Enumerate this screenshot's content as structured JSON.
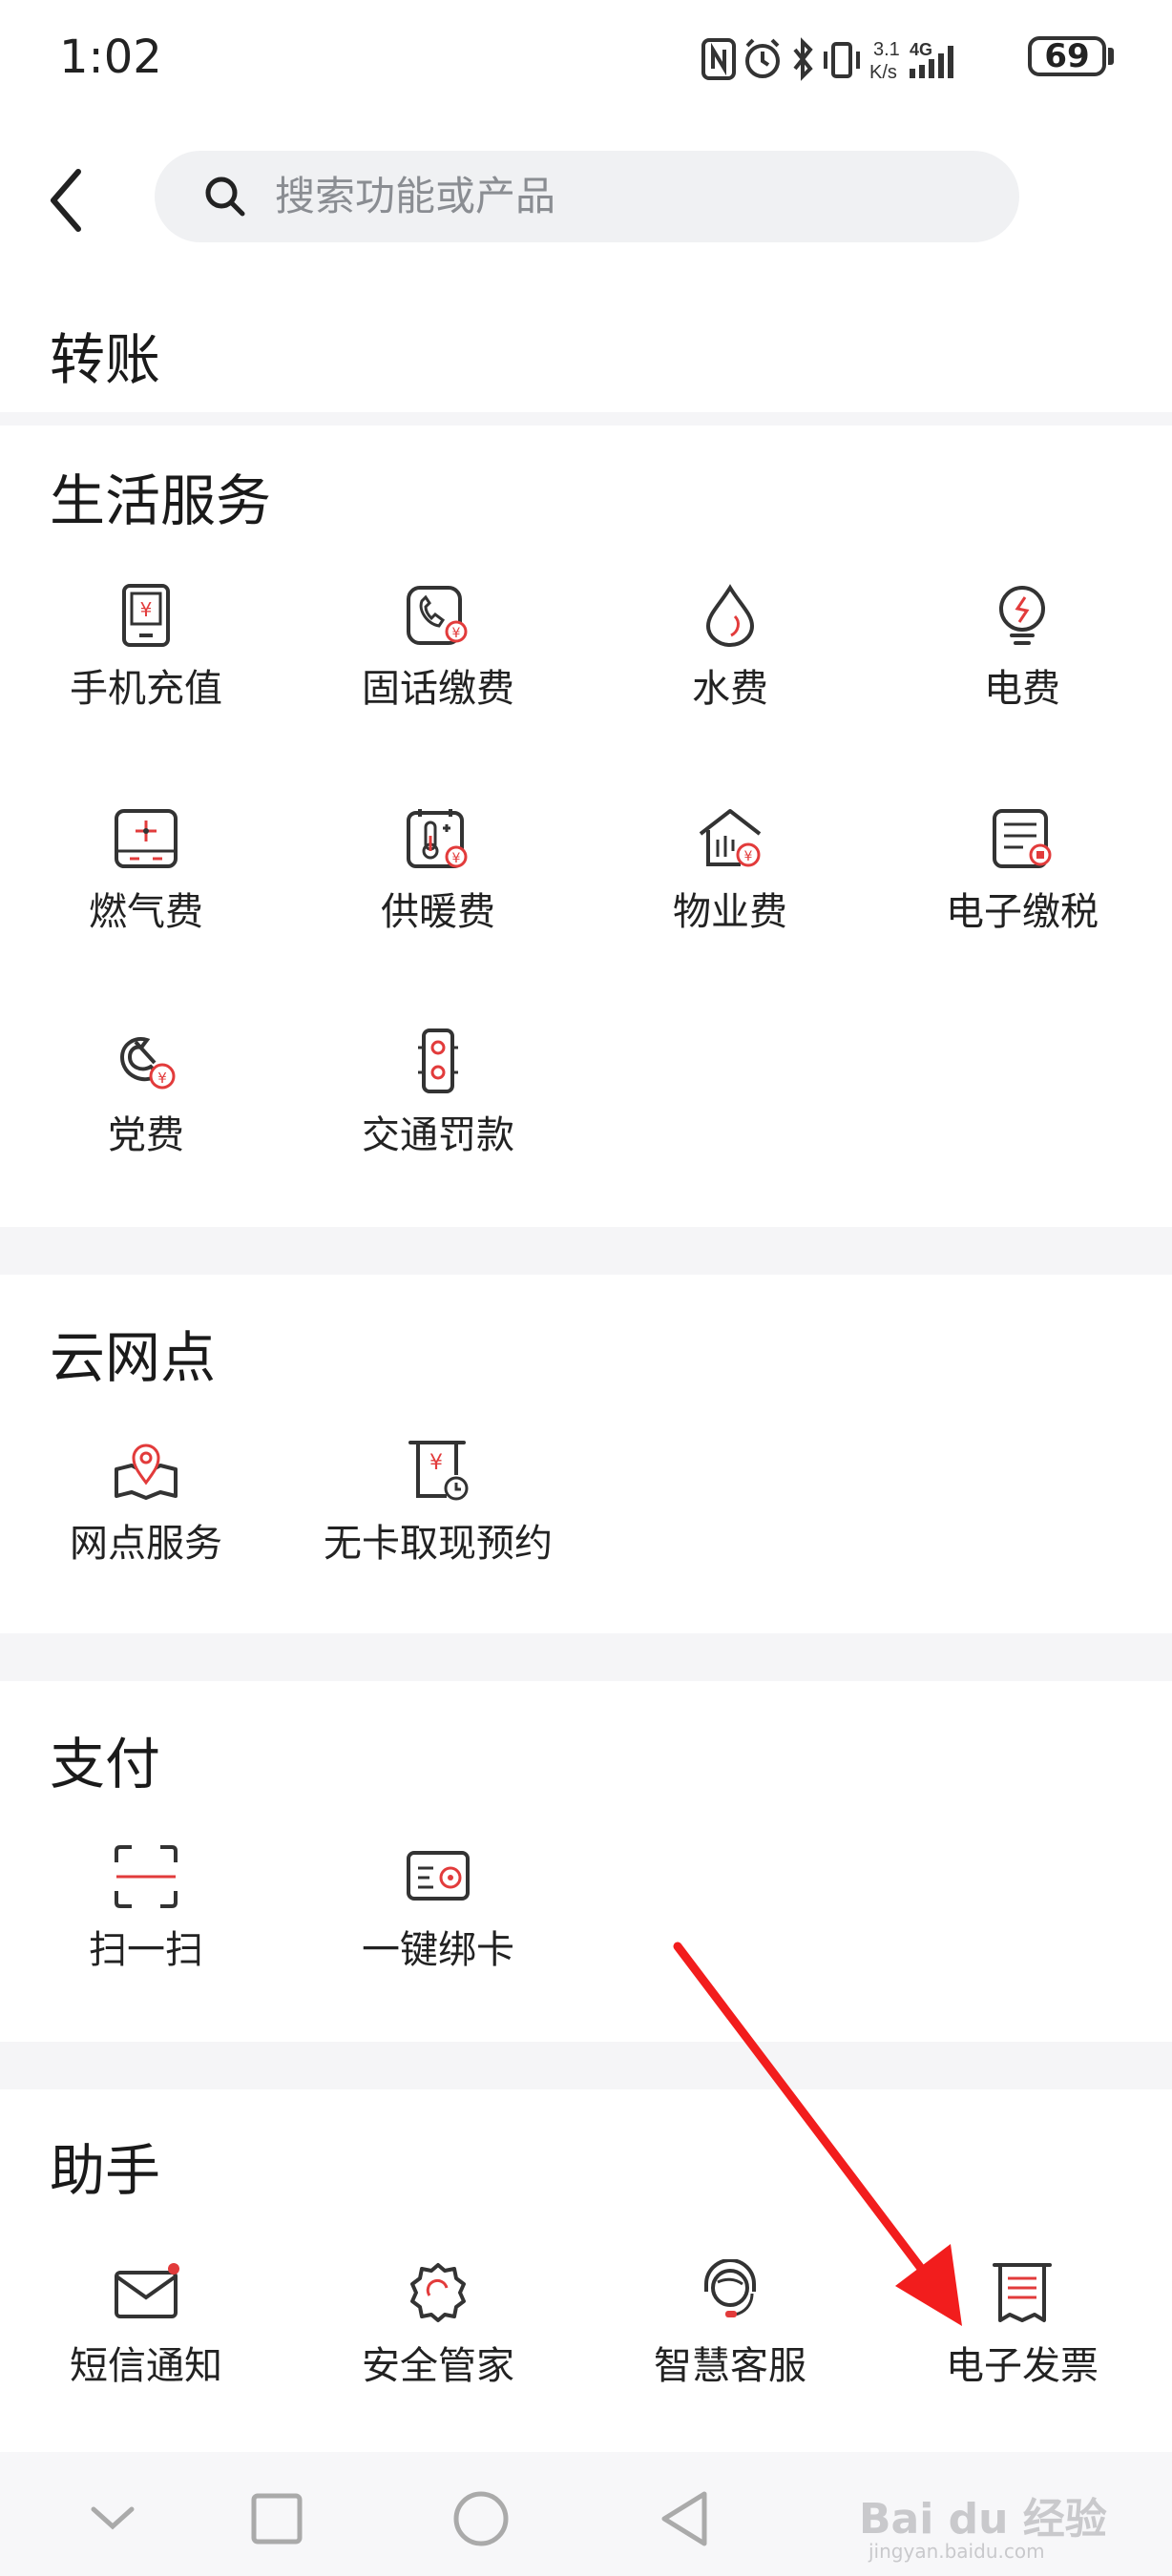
{
  "status_bar": {
    "time": "1:02",
    "net_speed_top": "3.1",
    "net_speed_bottom": "K/s",
    "network": "4G",
    "battery": "69"
  },
  "header": {
    "search_placeholder": "搜索功能或产品"
  },
  "sections": {
    "transfer": {
      "title": "转账"
    },
    "life": {
      "title": "生活服务",
      "items": [
        "手机充值",
        "固话缴费",
        "水费",
        "电费",
        "燃气费",
        "供暖费",
        "物业费",
        "电子缴税",
        "党费",
        "交通罚款"
      ]
    },
    "cloud": {
      "title": "云网点",
      "items": [
        "网点服务",
        "无卡取现预约"
      ]
    },
    "pay": {
      "title": "支付",
      "items": [
        "扫一扫",
        "一键绑卡"
      ]
    },
    "assistant": {
      "title": "助手",
      "items": [
        "短信通知",
        "安全管家",
        "智慧客服",
        "电子发票"
      ]
    }
  },
  "watermark": {
    "brand": "Bai du 经验",
    "url": "jingyan.baidu.com"
  },
  "colors": {
    "accent_red": "#e23b3b",
    "icon_stroke": "#333333",
    "band_gray": "#f5f5f7",
    "arrow_red": "#f21d1d"
  }
}
